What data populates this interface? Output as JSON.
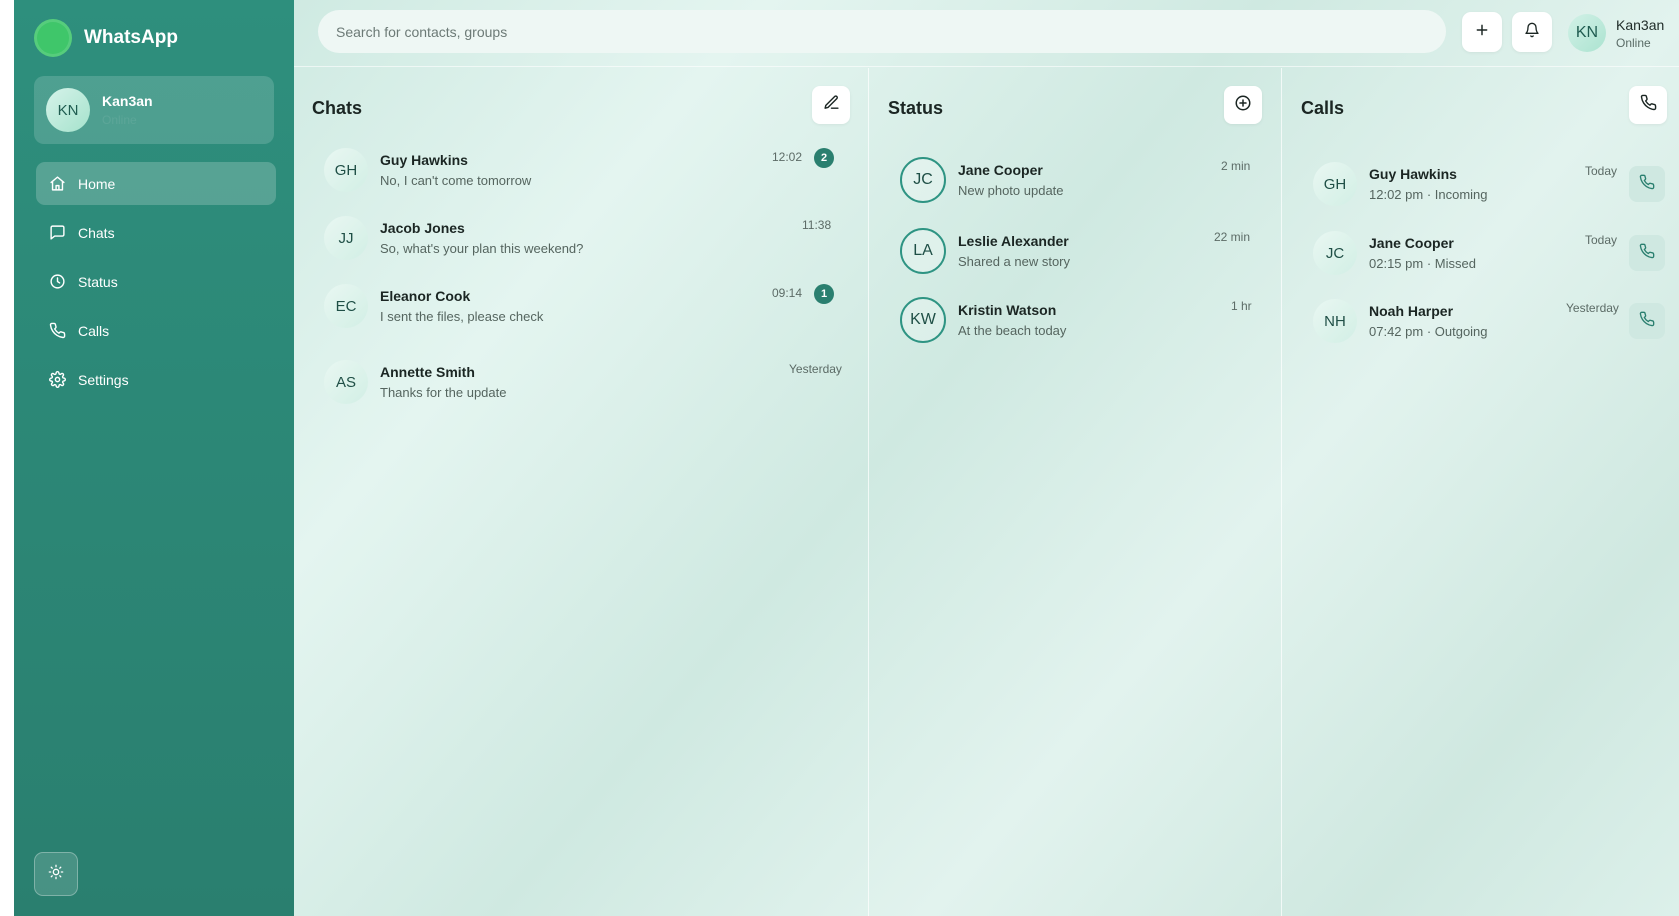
{
  "brand": {
    "name": "WhatsApp"
  },
  "profile": {
    "initials": "KN",
    "name": "Kan3an",
    "status": "Online"
  },
  "nav": [
    {
      "label": "Home",
      "icon": "home-icon",
      "active": true
    },
    {
      "label": "Chats",
      "icon": "chat-bubble-icon"
    },
    {
      "label": "Status",
      "icon": "clock-icon"
    },
    {
      "label": "Calls",
      "icon": "phone-icon"
    },
    {
      "label": "Settings",
      "icon": "gear-icon"
    }
  ],
  "topbar": {
    "search_placeholder": "Search for contacts, groups",
    "user": {
      "initials": "KN",
      "name": "Kan3an",
      "status": "Online"
    }
  },
  "chats": {
    "title": "Chats",
    "items": [
      {
        "initials": "GH",
        "name": "Guy Hawkins",
        "message": "No, I can't come tomorrow",
        "time": "12:02",
        "unread": "2"
      },
      {
        "initials": "JJ",
        "name": "Jacob Jones",
        "message": "So, what's your plan this weekend?",
        "time": "11:38",
        "unread": ""
      },
      {
        "initials": "EC",
        "name": "Eleanor Cook",
        "message": "I sent the files, please check",
        "time": "09:14",
        "unread": "1"
      },
      {
        "initials": "AS",
        "name": "Annette Smith",
        "message": "Thanks for the update",
        "time": "Yesterday",
        "unread": ""
      }
    ]
  },
  "status": {
    "title": "Status",
    "items": [
      {
        "initials": "JC",
        "name": "Jane Cooper",
        "text": "New photo update",
        "time": "2 min"
      },
      {
        "initials": "LA",
        "name": "Leslie Alexander",
        "text": "Shared a new story",
        "time": "22 min"
      },
      {
        "initials": "KW",
        "name": "Kristin Watson",
        "text": "At the beach today",
        "time": "1 hr"
      }
    ]
  },
  "calls": {
    "title": "Calls",
    "items": [
      {
        "initials": "GH",
        "name": "Guy Hawkins",
        "detail": "12:02 pm · Incoming",
        "day": "Today"
      },
      {
        "initials": "JC",
        "name": "Jane Cooper",
        "detail": "02:15 pm · Missed",
        "day": "Today"
      },
      {
        "initials": "NH",
        "name": "Noah Harper",
        "detail": "07:42 pm · Outgoing",
        "day": "Yesterday"
      }
    ]
  },
  "colors": {
    "sidebar": "#2e8f7d",
    "accent": "#2a7f6f",
    "brand_dot": "#3fc66a"
  }
}
